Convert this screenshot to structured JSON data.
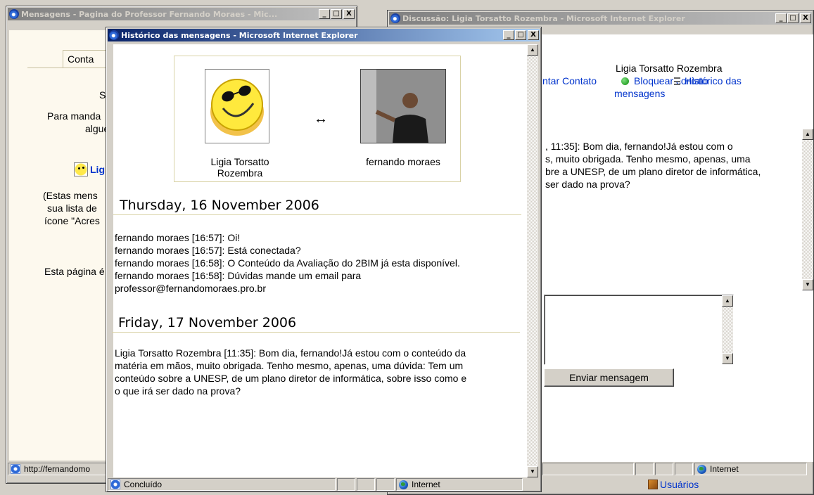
{
  "win_left": {
    "title": "Mensagens - Pagina do Professor Fernando Moraes - Mic...",
    "tab_label": "Conta",
    "line_s": "S",
    "line_para_manda": "Para manda",
    "line_alguem": "alguém",
    "contact_label": "Lig",
    "paren_1": "(Estas mens",
    "paren_2": "sua lista de",
    "paren_3": "ícone \"Acres",
    "esta_pagina": "Esta página é",
    "status_url": "http://fernandomo"
  },
  "win_right": {
    "title": "Discussão: Ligia Torsatto Rozembra - Microsoft Internet Explorer",
    "contact_name": "Ligia Torsatto Rozembra",
    "link_contato": "ntar Contato",
    "link_bloquear": "Bloquear contato",
    "link_bloquear_2": "mensagens",
    "link_historico": "Histórico das",
    "preview_lines": [
      ", 11:35]: Bom dia, fernando!Já estou com o",
      "s, muito obrigada. Tenho mesmo, apenas, uma",
      "bre a UNESP, de um plano diretor de informática,",
      "ser dado na prova?"
    ],
    "send_button": "Enviar mensagem",
    "status_zone": "Internet",
    "taskbar_item": "Usuários"
  },
  "win_history": {
    "title": "Histórico das mensagens - Microsoft Internet Explorer",
    "person_left": "Ligia Torsatto Rozembra",
    "arrow": "↔",
    "person_right": "fernando moraes",
    "day1": {
      "date": "Thursday, 16 November 2006",
      "lines": [
        "fernando moraes [16:57]: Oi!",
        "fernando moraes [16:57]: Está conectada?",
        "fernando moraes [16:58]: O Conteúdo da Avaliação do 2BIM já esta disponível.",
        "fernando moraes [16:58]: Dúvidas mande um email para",
        "professor@fernandomoraes.pro.br"
      ]
    },
    "day2": {
      "date": "Friday, 17 November 2006",
      "lines": [
        "Ligia Torsatto Rozembra [11:35]: Bom dia, fernando!Já estou com o conteúdo da",
        "matéria em mãos, muito obrigada. Tenho mesmo, apenas, uma dúvida: Tem um",
        "conteúdo sobre a UNESP, de um plano diretor de informática, sobre isso como e",
        "o que irá ser dado na prova?"
      ]
    },
    "status_text": "Concluído",
    "status_zone": "Internet"
  },
  "icons": {
    "minimize": "_",
    "maximize": "□",
    "close": "X",
    "scroll_up": "▲",
    "scroll_down": "▼"
  }
}
